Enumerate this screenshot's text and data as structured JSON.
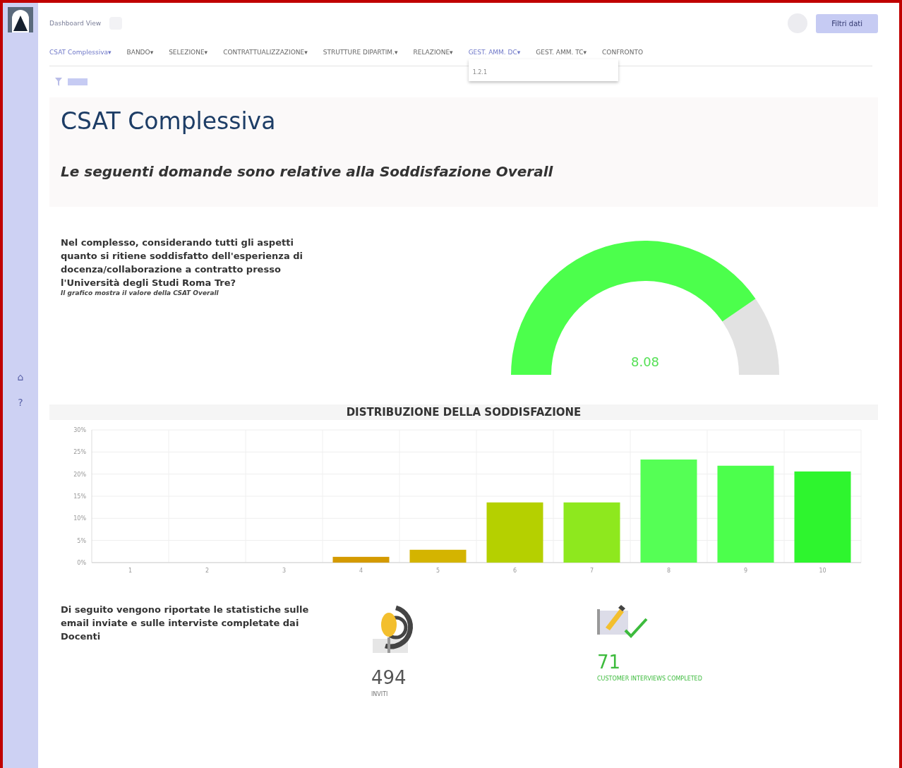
{
  "header": {
    "title": "Dashboard View",
    "filter_button": "Filtri dati"
  },
  "nav": [
    {
      "label": "CSAT Complessiva",
      "caret": "▾",
      "selected": true
    },
    {
      "label": "BANDO",
      "caret": "▾",
      "selected": false
    },
    {
      "label": "SELEZIONE",
      "caret": "▾",
      "selected": false
    },
    {
      "label": "CONTRATTUALIZZAZIONE",
      "caret": "▾",
      "selected": false
    },
    {
      "label": "STRUTTURE DIPARTIM.",
      "caret": "▾",
      "selected": false
    },
    {
      "label": "RELAZIONE",
      "caret": "▾",
      "selected": false
    },
    {
      "label": "GEST. AMM. DC",
      "caret": "▾",
      "selected": true
    },
    {
      "label": "GEST. AMM. TC",
      "caret": "▾",
      "selected": false
    },
    {
      "label": "CONFRONTO",
      "selected": false
    }
  ],
  "dropdown": {
    "items": [
      "1.2.1"
    ]
  },
  "sidebar": {
    "icons": [
      "⌂",
      "?"
    ]
  },
  "banner": {
    "title": "CSAT Complessiva",
    "subtitle": "Le seguenti domande sono relative alla Soddisfazione Overall"
  },
  "question": {
    "text": "Nel complesso, considerando tutti gli aspetti quanto si ritiene soddisfatto dell'esperienza di docenza/collaborazione a contratto presso l'Università degli Studi Roma Tre?",
    "note": "Il grafico mostra il valore della CSAT Overall"
  },
  "gauge": {
    "reading": "8.08"
  },
  "distribution": {
    "title": "DISTRIBUZIONE DELLA SODDISFAZIONE",
    "chart_data": {
      "type": "bar",
      "categories": [
        "1",
        "2",
        "3",
        "4",
        "5",
        "6",
        "7",
        "8",
        "9",
        "10"
      ],
      "series": [
        {
          "values": [
            0,
            0,
            0,
            1.3,
            2.9,
            13.6,
            13.6,
            23.3,
            21.9,
            20.6
          ]
        }
      ],
      "ylim": [
        0,
        30
      ],
      "grid": true,
      "yticks": [
        {
          "value": 0,
          "label": "0%"
        },
        {
          "value": 5,
          "label": "5%"
        },
        {
          "value": 10,
          "label": "10%"
        },
        {
          "value": 15,
          "label": "15%"
        },
        {
          "value": 20,
          "label": "20%"
        },
        {
          "value": 25,
          "label": "25%"
        },
        {
          "value": 30,
          "label": "30%"
        }
      ]
    }
  },
  "stats": {
    "intro": "Di seguito vengono riportate le statistiche sulle email inviate e sulle interviste completate dai Docenti",
    "items": [
      {
        "kind": "invites",
        "value": "494",
        "label": "INVITI"
      },
      {
        "kind": "completed",
        "value": "71",
        "label": "CUSTOMER INTERVIEWS COMPLETED"
      }
    ]
  }
}
